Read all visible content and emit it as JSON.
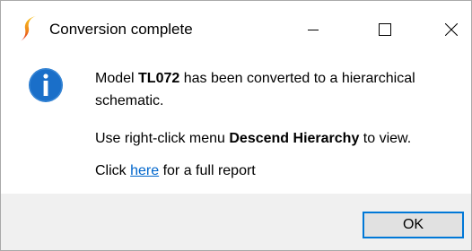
{
  "window": {
    "title": "Conversion complete",
    "app_icon": "simetrix-logo-icon",
    "controls": {
      "minimize_icon": "minimize-icon",
      "maximize_icon": "maximize-icon",
      "close_icon": "close-icon"
    }
  },
  "message": {
    "icon": "info-icon",
    "line1_prefix": "Model ",
    "model_name": "TL072",
    "line1_suffix": " has been converted to a hierarchical",
    "line1_cont": "schematic.",
    "line2_prefix": "Use right-click menu ",
    "menu_item": "Descend Hierarchy",
    "line2_suffix": " to view.",
    "line3_prefix": "Click ",
    "link_text": "here",
    "line3_suffix": " for a full report"
  },
  "buttons": {
    "ok_label": "OK"
  },
  "colors": {
    "accent": "#0078d7",
    "info_icon_fill": "#1a6fc9",
    "link": "#0066cc",
    "footer_bg": "#f0f0f0",
    "logo_top": "#f5b51e",
    "logo_bottom": "#e2231a"
  }
}
